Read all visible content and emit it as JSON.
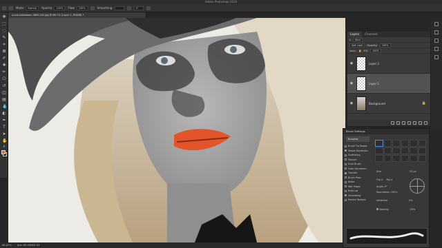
{
  "app": {
    "title": "Adobe Photoshop 2020"
  },
  "options_bar": {
    "mode_label": "Mode:",
    "mode_value": "Normal",
    "opacity_label": "Opacity:",
    "opacity_value": "100%",
    "flow_label": "Flow:",
    "flow_value": "100%",
    "smoothing_label": "Smoothing:",
    "angle_value": "0°"
  },
  "document": {
    "tab_title": "uncle-halloween-5881148.jpg @ 66.7% (Layer 1, RGB/8) *"
  },
  "status": {
    "zoom": "66.67%",
    "doc_size": "Doc: 89.1M/89.1M"
  },
  "layers_panel": {
    "tabs": [
      "Layers",
      "Channels"
    ],
    "kind_label": "Kind",
    "blend_mode": "Soft Light",
    "opacity_label": "Opacity:",
    "opacity_value": "100%",
    "lock_label": "Lock:",
    "fill_label": "Fill:",
    "fill_value": "100%",
    "layers": [
      {
        "name": "Layer 2",
        "visible": true,
        "selected": false
      },
      {
        "name": "Layer 1",
        "visible": true,
        "selected": true
      },
      {
        "name": "Background",
        "visible": true,
        "selected": false,
        "locked": true
      }
    ]
  },
  "brush_panel": {
    "title": "Brush Settings",
    "brushes_button": "Brushes",
    "options": [
      {
        "label": "Brush Tip Shape",
        "checked": false
      },
      {
        "label": "Shape Dynamics",
        "checked": true
      },
      {
        "label": "Scattering",
        "checked": false
      },
      {
        "label": "Texture",
        "checked": false
      },
      {
        "label": "Dual Brush",
        "checked": false
      },
      {
        "label": "Color Dynamics",
        "checked": false
      },
      {
        "label": "Transfer",
        "checked": true
      },
      {
        "label": "Brush Pose",
        "checked": false
      },
      {
        "label": "Noise",
        "checked": false
      },
      {
        "label": "Wet Edges",
        "checked": false
      },
      {
        "label": "Build-up",
        "checked": false
      },
      {
        "label": "Smoothing",
        "checked": true
      },
      {
        "label": "Protect Texture",
        "checked": false
      }
    ],
    "size_label": "Size",
    "size_value": "53 px",
    "flip_x": "Flip X",
    "flip_y": "Flip Y",
    "angle_label": "Angle:",
    "angle_value": "0°",
    "roundness_label": "Roundness:",
    "roundness_value": "100%",
    "hardness_label": "Hardness",
    "hardness_value": "0%",
    "spacing_label": "Spacing",
    "spacing_value": "25%"
  }
}
